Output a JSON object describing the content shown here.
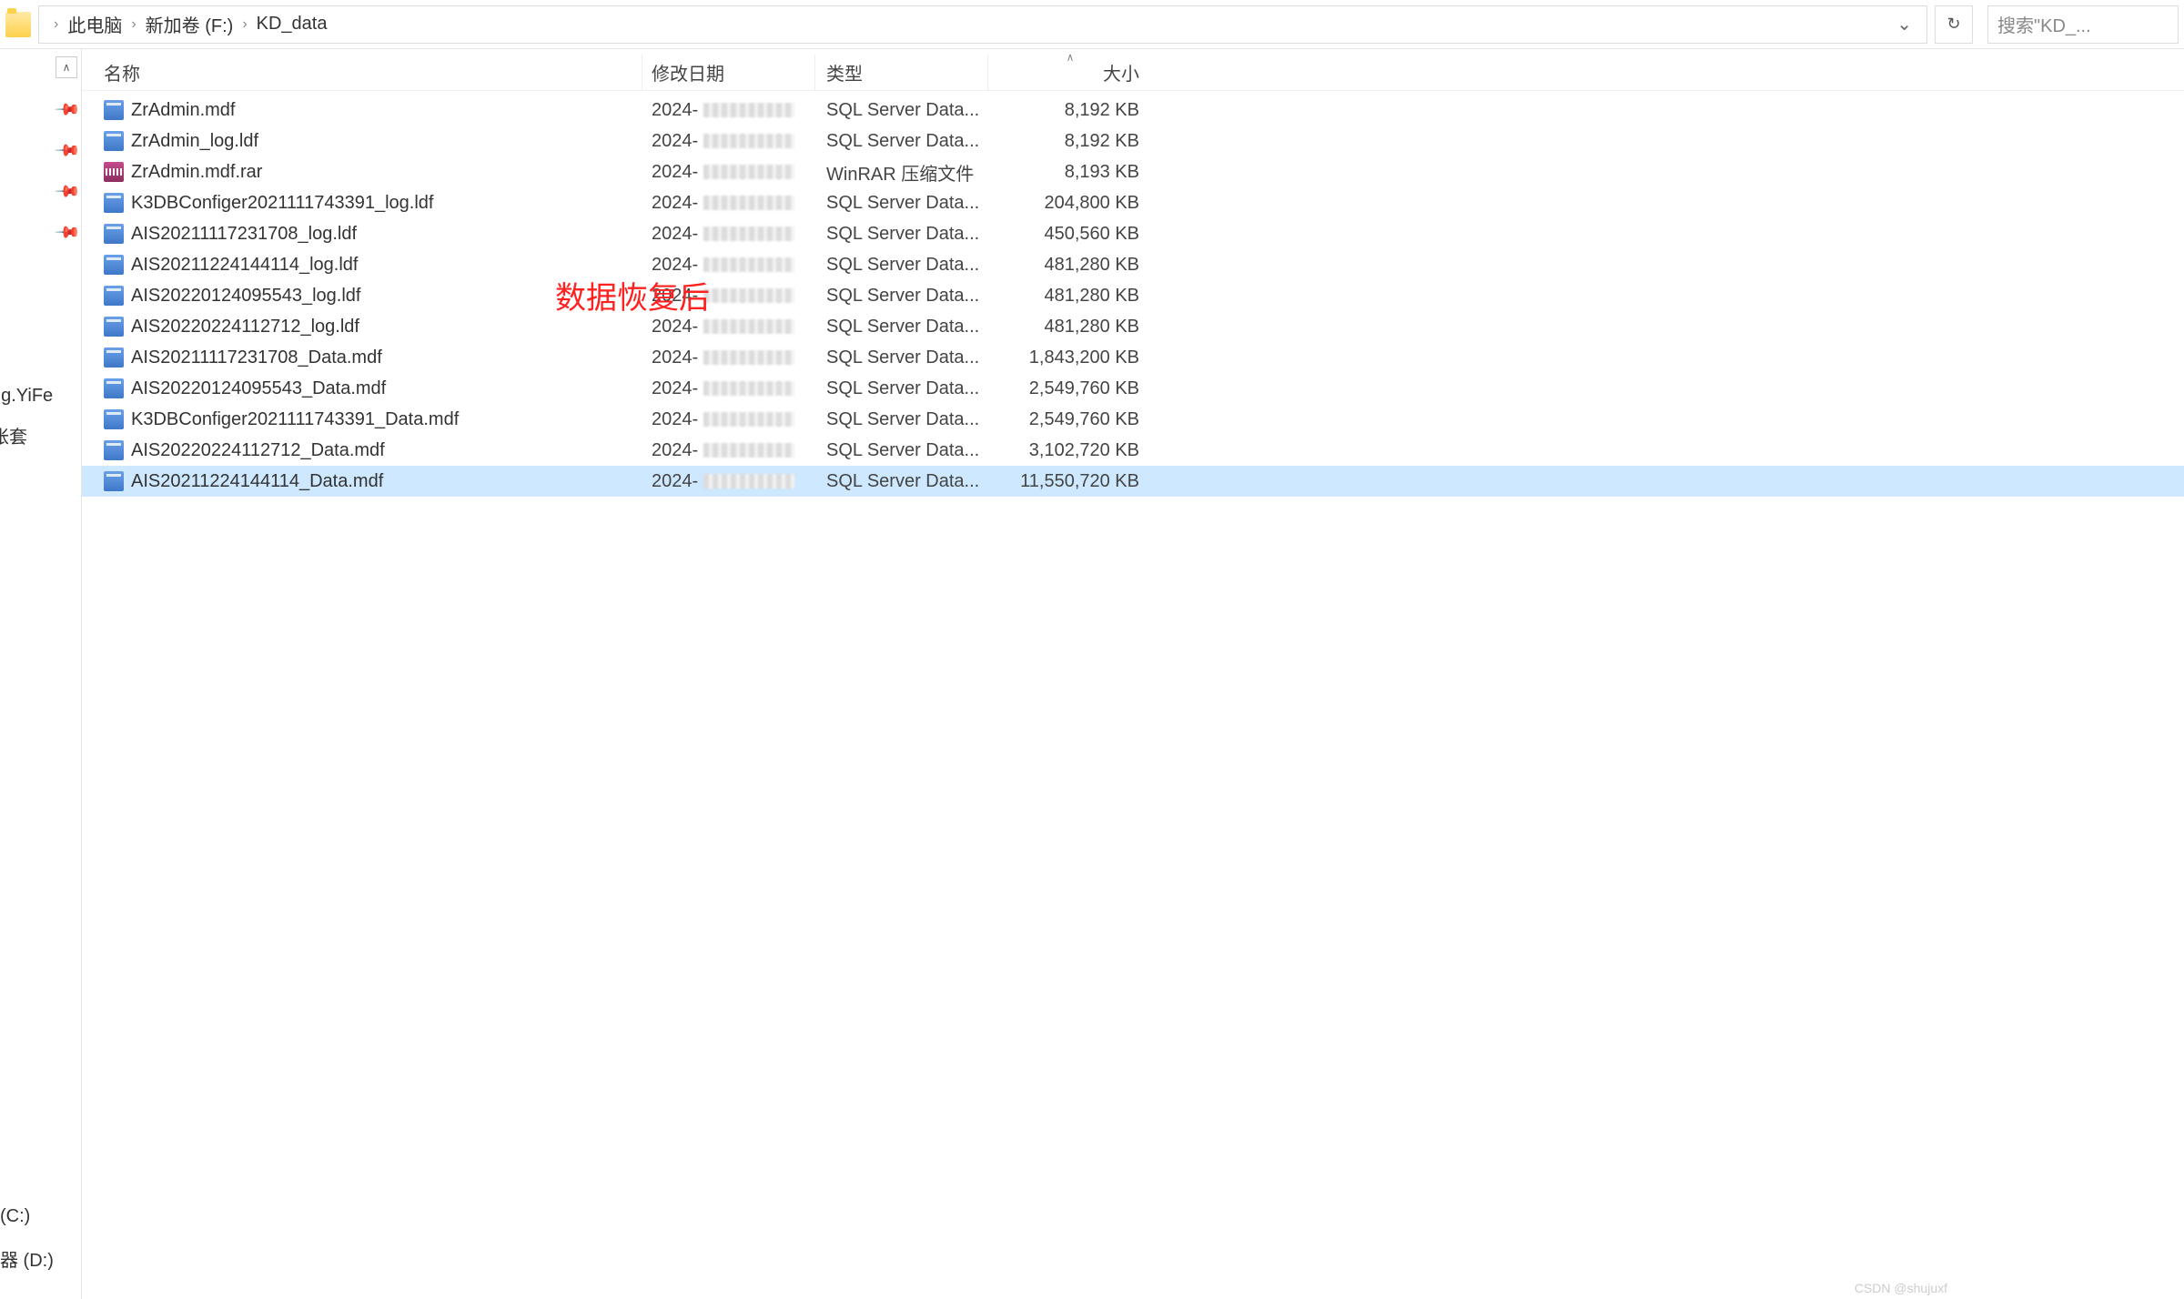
{
  "addressbar": {
    "crumbs": [
      "此电脑",
      "新加卷 (F:)",
      "KD_data"
    ]
  },
  "search": {
    "placeholder": "搜索\"KD_..."
  },
  "sidebar": {
    "partial_labels": [
      "ng.YiFe",
      "帐套"
    ],
    "drive_labels": [
      "(C:)",
      "器 (D:)"
    ]
  },
  "columns": {
    "name": "名称",
    "date": "修改日期",
    "type": "类型",
    "size": "大小"
  },
  "annotation": "数据恢复后",
  "watermark": "CSDN @shujuxf",
  "type_labels": {
    "sql": "SQL Server Data...",
    "rar": "WinRAR 压缩文件"
  },
  "files": [
    {
      "icon": "db",
      "name": "ZrAdmin.mdf",
      "date_prefix": "2024-",
      "type_key": "sql",
      "size": "8,192 KB",
      "selected": false
    },
    {
      "icon": "db",
      "name": "ZrAdmin_log.ldf",
      "date_prefix": "2024-",
      "type_key": "sql",
      "size": "8,192 KB",
      "selected": false
    },
    {
      "icon": "rar",
      "name": "ZrAdmin.mdf.rar",
      "date_prefix": "2024-",
      "type_key": "rar",
      "size": "8,193 KB",
      "selected": false
    },
    {
      "icon": "db",
      "name": "K3DBConfiger2021111743391_log.ldf",
      "date_prefix": "2024-",
      "type_key": "sql",
      "size": "204,800 KB",
      "selected": false
    },
    {
      "icon": "db",
      "name": "AIS20211117231708_log.ldf",
      "date_prefix": "2024-",
      "type_key": "sql",
      "size": "450,560 KB",
      "selected": false
    },
    {
      "icon": "db",
      "name": "AIS20211224144114_log.ldf",
      "date_prefix": "2024-",
      "type_key": "sql",
      "size": "481,280 KB",
      "selected": false
    },
    {
      "icon": "db",
      "name": "AIS20220124095543_log.ldf",
      "date_prefix": "2024-",
      "type_key": "sql",
      "size": "481,280 KB",
      "selected": false
    },
    {
      "icon": "db",
      "name": "AIS20220224112712_log.ldf",
      "date_prefix": "2024-",
      "type_key": "sql",
      "size": "481,280 KB",
      "selected": false
    },
    {
      "icon": "db",
      "name": "AIS20211117231708_Data.mdf",
      "date_prefix": "2024-",
      "type_key": "sql",
      "size": "1,843,200 KB",
      "selected": false
    },
    {
      "icon": "db",
      "name": "AIS20220124095543_Data.mdf",
      "date_prefix": "2024-",
      "type_key": "sql",
      "size": "2,549,760 KB",
      "selected": false
    },
    {
      "icon": "db",
      "name": "K3DBConfiger2021111743391_Data.mdf",
      "date_prefix": "2024-",
      "type_key": "sql",
      "size": "2,549,760 KB",
      "selected": false
    },
    {
      "icon": "db",
      "name": "AIS20220224112712_Data.mdf",
      "date_prefix": "2024-",
      "type_key": "sql",
      "size": "3,102,720 KB",
      "selected": false
    },
    {
      "icon": "db",
      "name": "AIS20211224144114_Data.mdf",
      "date_prefix": "2024-",
      "type_key": "sql",
      "size": "11,550,720 KB",
      "selected": true
    }
  ]
}
